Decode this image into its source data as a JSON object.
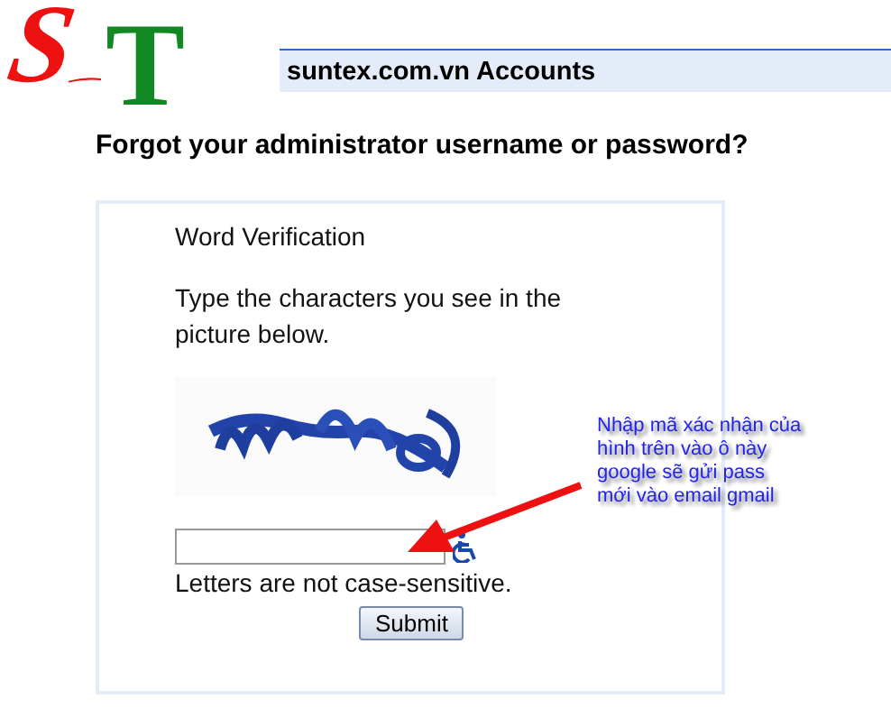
{
  "logo": {
    "letters": [
      {
        "text": "S",
        "color": "#ee1111"
      },
      {
        "text": "T",
        "color": "#118822"
      }
    ]
  },
  "header": {
    "title": "suntex.com.vn Accounts"
  },
  "heading": "Forgot your administrator username or password?",
  "verification": {
    "title": "Word Verification",
    "instructions": "Type the characters you see in the picture below.",
    "hint": "Letters are not case-sensitive.",
    "submit": "Submit"
  },
  "annotation": {
    "lines": [
      "Nhập mã xác nhận của",
      "hình trên vào ô này",
      "google sẽ gửi pass",
      "mới vào email gmail"
    ]
  }
}
